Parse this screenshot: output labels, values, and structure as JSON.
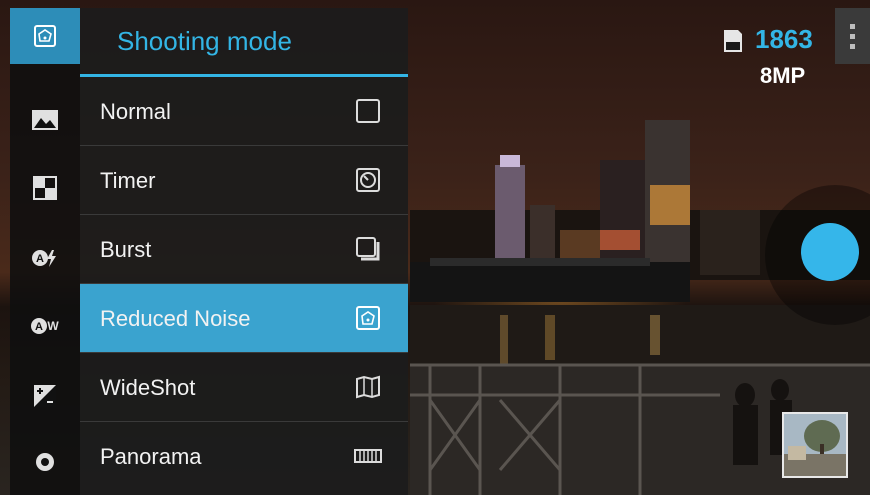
{
  "menu": {
    "title": "Shooting mode",
    "items": [
      {
        "label": "Normal",
        "icon": "square-outline-icon",
        "selected": false
      },
      {
        "label": "Timer",
        "icon": "timer-icon",
        "selected": false
      },
      {
        "label": "Burst",
        "icon": "burst-icon",
        "selected": false
      },
      {
        "label": "Reduced Noise",
        "icon": "reduced-noise-icon",
        "selected": true
      },
      {
        "label": "WideShot",
        "icon": "wideshot-icon",
        "selected": false
      },
      {
        "label": "Panorama",
        "icon": "panorama-icon",
        "selected": false
      }
    ]
  },
  "rail": {
    "items": [
      {
        "icon": "shooting-mode-icon",
        "active": true
      },
      {
        "icon": "scene-icon",
        "active": false
      },
      {
        "icon": "effects-icon",
        "active": false
      },
      {
        "icon": "auto-flash-icon",
        "active": false
      },
      {
        "icon": "auto-white-balance-icon",
        "active": false
      },
      {
        "icon": "exposure-icon",
        "active": false
      },
      {
        "icon": "settings-icon",
        "active": false
      }
    ]
  },
  "status": {
    "shots_remaining": "1863",
    "resolution": "8MP",
    "storage_icon": "sd-card-icon"
  },
  "colors": {
    "accent": "#33b5e5",
    "selected_row": "#3aa3cf",
    "shutter": "#35b6ea"
  }
}
